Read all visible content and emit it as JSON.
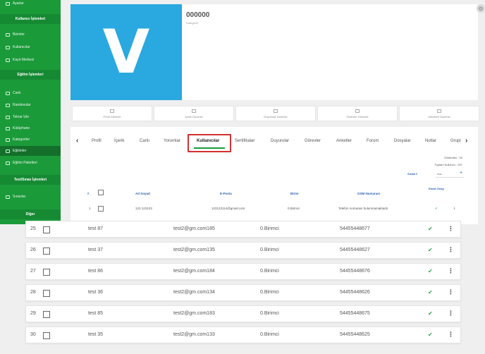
{
  "sidebar": {
    "top_item": "Ayarlar",
    "section_user": "Kullanıcı İşlemleri",
    "user_items": [
      "Birimler",
      "Kullanıcılar",
      "Kayıt Merkezi"
    ],
    "section_education": "Eğitim İşlemleri",
    "education_items": [
      "Canlı",
      "Randevular",
      "Tekrar İzle",
      "Kütüphane",
      "Kategoriler",
      "Eğitimler",
      "Eğitim Paketleri"
    ],
    "section_test": "Test/Sınav İşlemleri",
    "test_items": [
      "Sınavlar"
    ],
    "section_other": "Diğer"
  },
  "header": {
    "code": "000000",
    "category": "Kategorili",
    "logo_letter": "V"
  },
  "edit_buttons": [
    "Profil Düzenle",
    "İçerik Düzenle",
    "Duyurular Düzenle",
    "Görevler Düzenle",
    "Anketleri Düzenle"
  ],
  "tabs": [
    "Profil",
    "İçerik",
    "Canlı",
    "Yorumlar",
    "Kullanıcılar",
    "Sertifikalar",
    "Duyurular",
    "Görevler",
    "Anketler",
    "Forum",
    "Dosyalar",
    "Notlar",
    "Grupl"
  ],
  "active_tab": "Kullanıcılar",
  "table_info": {
    "showing": "Gösterilen : 00",
    "total": "Toplam Kullanıcı : 207",
    "sort_label": "Sırala",
    "search_placeholder": "Ara..."
  },
  "columns": [
    "#",
    "Ad Soyad",
    "E-Posta",
    "Birim",
    "GSM Numarası",
    "Email Onay"
  ],
  "first_row": {
    "num": "1",
    "name": "123 123123",
    "email": "123123114@gmail.com",
    "unit": "0.Birimci",
    "gsm": "Telefon numarası bulunmamaktadır"
  },
  "rows": [
    {
      "num": "25",
      "name": "test 87",
      "email": "test2@gm.com185",
      "unit": "0.Birimci",
      "gsm": "54455448677"
    },
    {
      "num": "26",
      "name": "test 37",
      "email": "test2@gm.com135",
      "unit": "0.Birimci",
      "gsm": "54455448627"
    },
    {
      "num": "27",
      "name": "test 86",
      "email": "test2@gm.com184",
      "unit": "0.Birimci",
      "gsm": "54455448676"
    },
    {
      "num": "28",
      "name": "test 36",
      "email": "test2@gm.com134",
      "unit": "0.Birimci",
      "gsm": "54455448626"
    },
    {
      "num": "29",
      "name": "test 85",
      "email": "test2@gm.com183",
      "unit": "0.Birimci",
      "gsm": "54455448675"
    },
    {
      "num": "30",
      "name": "test 35",
      "email": "test2@gm.com133",
      "unit": "0.Birimci",
      "gsm": "54455448625"
    }
  ],
  "colors": {
    "sidebar": "#1b9a3a",
    "logo": "#2aa8e0",
    "highlight": "#d23030",
    "accent": "#2c5fb0"
  }
}
